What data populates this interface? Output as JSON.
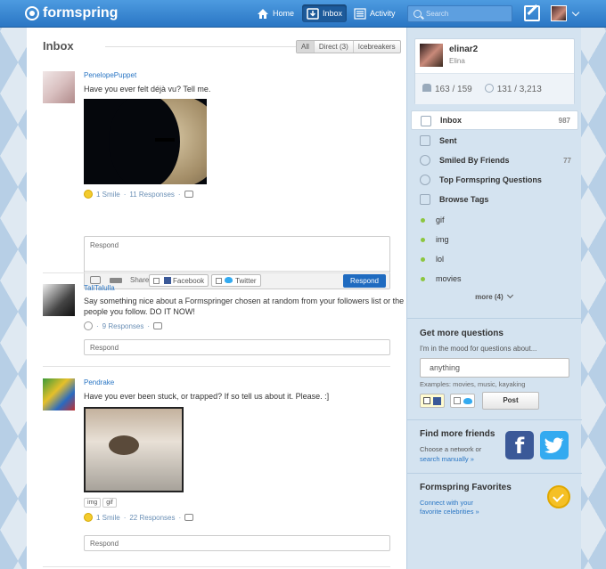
{
  "header": {
    "logo": "formspring",
    "nav": {
      "home": "Home",
      "inbox": "Inbox",
      "activity": "Activity"
    },
    "search_placeholder": "Search"
  },
  "inbox": {
    "title": "Inbox",
    "filters": [
      "All",
      "Direct (3)",
      "Icebreakers"
    ]
  },
  "questions": [
    {
      "asker": "PenelopePuppet",
      "text": "Have you ever felt déjà vu? Tell me.",
      "smiles": "1 Smile",
      "responses": "11 Responses",
      "respond_placeholder": "Respond",
      "share_label": "Share",
      "facebook": "Facebook",
      "twitter": "Twitter",
      "respond_button": "Respond"
    },
    {
      "asker": "TaliTalulla",
      "text": "Say something nice about a Formspringer chosen at random from your followers list or the people you follow. DO IT NOW!",
      "responses": "9 Responses",
      "respond_placeholder": "Respond"
    },
    {
      "asker": "Pendrake",
      "text": "Have you ever been stuck, or trapped? If so tell us about it. Please. :]",
      "tags": [
        "img",
        "gif"
      ],
      "smiles": "1 Smile",
      "responses": "22 Responses",
      "respond_placeholder": "Respond"
    }
  ],
  "profile": {
    "username": "elinar2",
    "display_name": "Elina",
    "following": "163 / 159",
    "smiles": "131 / 3,213"
  },
  "sidebar_menu": [
    {
      "label": "Inbox",
      "count": "987"
    },
    {
      "label": "Sent",
      "count": ""
    },
    {
      "label": "Smiled By Friends",
      "count": "77"
    },
    {
      "label": "Top Formspring Questions",
      "count": ""
    },
    {
      "label": "Browse Tags",
      "count": ""
    }
  ],
  "tags": [
    "gif",
    "img",
    "lol",
    "movies"
  ],
  "more_label": "more (4)",
  "get_questions": {
    "title": "Get more questions",
    "prompt": "I'm in the mood for questions about...",
    "value": "anything",
    "examples": "Examples: movies, music, kayaking",
    "post": "Post"
  },
  "find_friends": {
    "title": "Find more friends",
    "line1": "Choose a network or",
    "link": "search manually »"
  },
  "favorites": {
    "title": "Formspring Favorites",
    "link1": "Connect with your",
    "link2": "favorite celebrities »"
  },
  "colors": {
    "brand_blue": "#2a76c4",
    "respond_button": "#1f6bc0",
    "tag_dot": "#8cc63f"
  }
}
